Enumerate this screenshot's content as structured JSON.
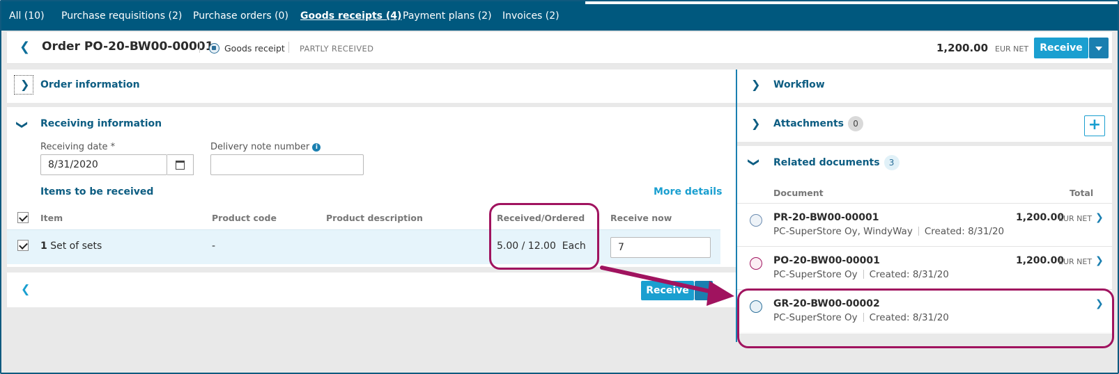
{
  "tabs": [
    {
      "label": "All (10)"
    },
    {
      "label": "Purchase requisitions (2)"
    },
    {
      "label": "Purchase orders (0)"
    },
    {
      "label": "Goods receipts (4)"
    },
    {
      "label": "Payment plans (2)"
    },
    {
      "label": "Invoices (2)"
    }
  ],
  "header": {
    "title": "Order PO-20-BW00-00001",
    "doc_type": "Goods receipt",
    "status": "PARTLY RECEIVED",
    "total": "1,200.00",
    "currency": "EUR NET",
    "receive_label": "Receive"
  },
  "order_info": {
    "title": "Order information"
  },
  "receiving": {
    "title": "Receiving information",
    "date_label": "Receiving date *",
    "date_value": "8/31/2020",
    "delivery_label": "Delivery note number",
    "delivery_value": "",
    "items_title": "Items to be received",
    "more_details": "More details",
    "columns": {
      "item": "Item",
      "product_code": "Product code",
      "product_description": "Product description",
      "received_ordered": "Received/Ordered",
      "receive_now": "Receive now"
    },
    "row": {
      "qty": "1",
      "item": "Set of sets",
      "product_code": "-",
      "product_description": "",
      "received_ordered": "5.00 / 12.00  Each",
      "receive_now": "7"
    },
    "footer_receive_label": "Receive"
  },
  "right": {
    "workflow": "Workflow",
    "attachments": "Attachments",
    "attachments_count": "0",
    "related": "Related documents",
    "related_count": "3",
    "col_document": "Document",
    "col_total": "Total",
    "documents": [
      {
        "name": "PR-20-BW00-00001",
        "supplier": "PC-SuperStore Oy, WindyWay",
        "created": "Created: 8/31/20",
        "amount": "1,200.00",
        "currency": "EUR NET",
        "icon": "cart-icon"
      },
      {
        "name": "PO-20-BW00-00001",
        "supplier": "PC-SuperStore Oy",
        "created": "Created: 8/31/20",
        "amount": "1,200.00",
        "currency": "EUR NET",
        "icon": "purchase-order-icon"
      },
      {
        "name": "GR-20-BW00-00002",
        "supplier": "PC-SuperStore Oy",
        "created": "Created: 8/31/20",
        "amount": "",
        "currency": "",
        "icon": "goods-receipt-icon"
      }
    ]
  },
  "colors": {
    "tabbar": "#00587e",
    "accent": "#1a9fd0",
    "annotation": "#a0135f",
    "heading": "#0d5d82"
  }
}
